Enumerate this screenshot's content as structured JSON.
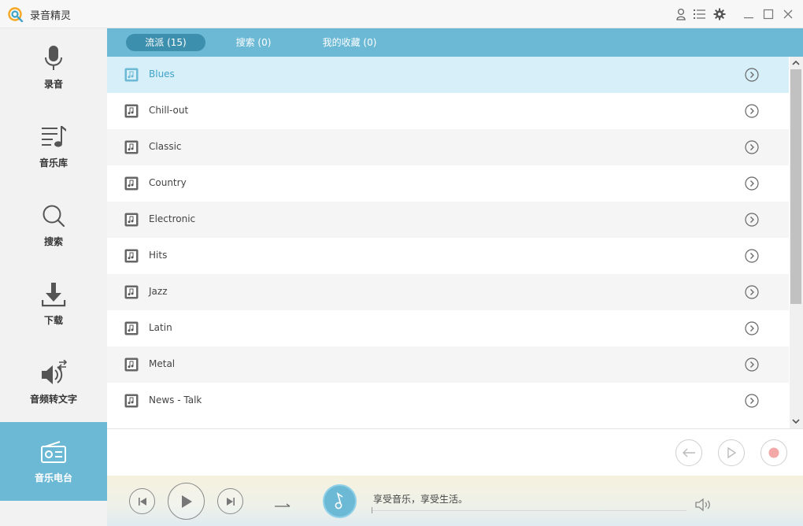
{
  "app": {
    "title": "录音精灵"
  },
  "titlebar": {
    "icons": [
      "user-icon",
      "menu-list-icon",
      "gear-icon",
      "minimize-icon",
      "maximize-icon",
      "close-icon"
    ]
  },
  "sidebar": {
    "items": [
      {
        "label": "录音",
        "icon": "microphone-icon",
        "active": false
      },
      {
        "label": "音乐库",
        "icon": "music-library-icon",
        "active": false
      },
      {
        "label": "搜索",
        "icon": "search-icon",
        "active": false
      },
      {
        "label": "下载",
        "icon": "download-icon",
        "active": false
      },
      {
        "label": "音频转文字",
        "icon": "audio-to-text-icon",
        "active": false
      },
      {
        "label": "音乐电台",
        "icon": "radio-icon",
        "active": true
      }
    ]
  },
  "tabs": [
    {
      "label": "流派 (15)",
      "active": true
    },
    {
      "label": "搜索 (0)",
      "active": false
    },
    {
      "label": "我的收藏 (0)",
      "active": false
    }
  ],
  "genres": [
    {
      "name": "Blues",
      "selected": true
    },
    {
      "name": "Chill-out",
      "selected": false
    },
    {
      "name": "Classic",
      "selected": false
    },
    {
      "name": "Country",
      "selected": false
    },
    {
      "name": "Electronic",
      "selected": false
    },
    {
      "name": "Hits",
      "selected": false
    },
    {
      "name": "Jazz",
      "selected": false
    },
    {
      "name": "Latin",
      "selected": false
    },
    {
      "name": "Metal",
      "selected": false
    },
    {
      "name": "News - Talk",
      "selected": false
    }
  ],
  "actions": {
    "icons": [
      "back-arrow-icon",
      "play-outline-icon",
      "record-icon"
    ]
  },
  "player": {
    "now_playing": "享受音乐，享受生活。",
    "icons": [
      "previous-icon",
      "play-icon",
      "next-icon",
      "repeat-icon",
      "music-note-icon",
      "volume-icon"
    ]
  },
  "colors": {
    "accent": "#6cb9d6",
    "tab_active": "#3d8fae",
    "row_selected": "#d6eff8",
    "row_alt": "#f5f5f5",
    "record": "#f06f70"
  }
}
